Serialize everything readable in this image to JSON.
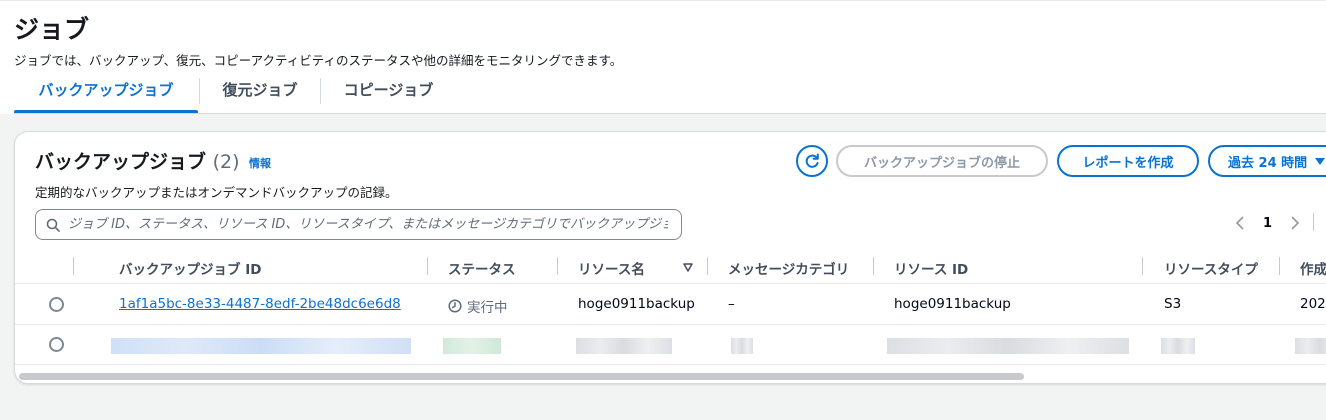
{
  "page": {
    "title": "ジョブ",
    "description": "ジョブでは、バックアップ、復元、コピーアクティビティのステータスや他の詳細をモニタリングできます。"
  },
  "tabs": [
    {
      "label": "バックアップジョブ",
      "active": true
    },
    {
      "label": "復元ジョブ",
      "active": false
    },
    {
      "label": "コピージョブ",
      "active": false
    }
  ],
  "panel": {
    "title": "バックアップジョブ",
    "count": "(2)",
    "info": "情報",
    "description": "定期的なバックアップまたはオンデマンドバックアップの記録。",
    "stop_button": "バックアップジョブの停止",
    "report_button": "レポートを作成",
    "range_button": "過去 24 時間",
    "search_placeholder": "ジョブ ID、ステータス、リソース ID、リソースタイプ、またはメッセージカテゴリでバックアップジョブを検索",
    "page_number": "1"
  },
  "table": {
    "columns": [
      "バックアップジョブ ID",
      "ステータス",
      "リソース名",
      "メッセージカテゴリ",
      "リソース ID",
      "リソースタイプ",
      "作成"
    ],
    "rows": [
      {
        "job_id": "1af1a5bc-8e33-4487-8edf-2be48dc6e6d8",
        "status": "実行中",
        "resource_name": "hoge0911backup",
        "message_category": "–",
        "resource_id": "hoge0911backup",
        "resource_type": "S3",
        "created": "202"
      }
    ]
  },
  "colors": {
    "accent": "#0972d3",
    "text": "#000716",
    "muted": "#5f6b7a",
    "border": "#d5dbdb"
  },
  "icons": {
    "refresh": "refresh-icon",
    "search": "search-icon",
    "status": "clock-icon",
    "sort": "sort-desc-icon"
  }
}
